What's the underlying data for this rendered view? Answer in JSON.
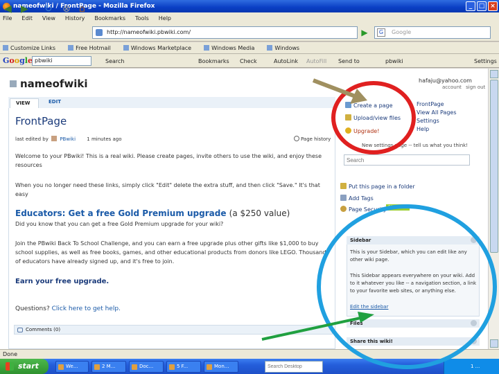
{
  "window": {
    "title": "nameofwiki / FrontPage - Mozilla Firefox"
  },
  "menubar": [
    "File",
    "Edit",
    "View",
    "History",
    "Bookmarks",
    "Tools",
    "Help"
  ],
  "navbar": {
    "url": "http://nameofwiki.pbwiki.com/",
    "search_placeholder": "Google"
  },
  "bookmarks": [
    "Customize Links",
    "Free Hotmail",
    "Windows Marketplace",
    "Windows Media",
    "Windows"
  ],
  "google_toolbar": {
    "logo": "Google",
    "input_value": "pbwiki",
    "items": [
      "Search",
      "Bookmarks",
      "Check",
      "AutoLink",
      "AutoFill",
      "Send to",
      "pbwiki",
      "Settings"
    ]
  },
  "wiki": {
    "name": "nameofwiki",
    "tabs": {
      "view": "VIEW",
      "edit": "EDIT"
    },
    "page_title": "FrontPage",
    "last_edited": "last edited by",
    "last_edited_user": "PBwiki",
    "last_edited_time": "1 minutes ago",
    "page_history": "Page history",
    "p1": "Welcome to your PBwiki! This is a real wiki. Please create pages, invite others to use the wiki, and enjoy these resources",
    "p2": "When you no longer need these links, simply click \"Edit\" delete the extra stuff, and then click \"Save.\" It's that easy",
    "educators_link": "Educators: Get a free Gold Premium upgrade",
    "educators_tail": "(a $250 value)",
    "p3": "Did you know that you can get a free Gold Premium upgrade for your wiki?",
    "p4": "Join the PBwiki Back To School Challenge, and you can earn a free upgrade plus other gifts like $1,000 to buy school supplies, as well as free books, games, and other educational products from donors like LEGO. Thousands of educators have already signed up, and it's free to join.",
    "earn": "Earn your free upgrade.",
    "questions": "Questions?",
    "questions_link": "Click here to get help.",
    "comments": "Comments (0)"
  },
  "right": {
    "user_email": "hafaju@yahoo.com",
    "account": "account",
    "sign_out": "sign out",
    "create_page": "Create a page",
    "upload": "Upload/view files",
    "upgrade": "Upgrade!",
    "frontpage": "FrontPage",
    "view_all": "View All Pages",
    "settings": "Settings",
    "help": "Help",
    "feedback": "New settings page -- tell us what you think!",
    "search_placeholder": "Search",
    "put_folder": "Put this page in a folder",
    "add_tags": "Add Tags",
    "page_security": "Page Security",
    "premium": "PREMIUM",
    "sidebar_title": "Sidebar",
    "sidebar_p1": "This is your Sidebar, which you can edit like any other wiki page.",
    "sidebar_p2": "This Sidebar appears everywhere on your wiki. Add to it whatever you like -- a navigation section, a link to your favorite web sites, or anything else.",
    "edit_sidebar": "Edit the sidebar",
    "files_title": "Files",
    "share_title": "Share this wiki!"
  },
  "status": {
    "text": "Done"
  },
  "taskbar": {
    "start": "start",
    "tasks": [
      "We...",
      "2 M...",
      "Doc...",
      "5 F...",
      "Mon..."
    ],
    "desktop_search": "Search Desktop",
    "time": "1 ..."
  },
  "annotations": {
    "red": "#e02020",
    "blue": "#20a0e0",
    "green": "#20a040",
    "olive": "#a09060"
  }
}
